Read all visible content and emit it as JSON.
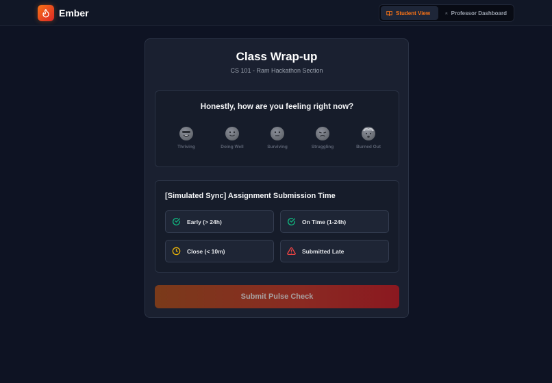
{
  "header": {
    "brand": "Ember",
    "accent": "#f97316",
    "logo_icon": "flame-icon",
    "tabs": [
      {
        "label": "Student View",
        "icon": "book-icon",
        "active": true
      },
      {
        "label": "Professor Dashboard",
        "icon": "users-icon",
        "active": false
      }
    ]
  },
  "card": {
    "title": "Class Wrap-up",
    "subtitle": "CS 101 - Ram Hackathon Section"
  },
  "mood": {
    "question": "Honestly, how are you feeling right now?",
    "options": [
      {
        "label": "Thriving",
        "icon": "star-struck-face-icon"
      },
      {
        "label": "Doing Well",
        "icon": "smiling-face-icon"
      },
      {
        "label": "Surviving",
        "icon": "neutral-face-icon"
      },
      {
        "label": "Struggling",
        "icon": "weary-face-icon"
      },
      {
        "label": "Burned Out",
        "icon": "exploding-head-icon"
      }
    ]
  },
  "sync": {
    "title": "[Simulated Sync] Assignment Submission Time",
    "options": [
      {
        "label": "Early (> 24h)",
        "icon": "check-circle-icon",
        "color": "#10b981"
      },
      {
        "label": "On Time (1-24h)",
        "icon": "check-circle-icon",
        "color": "#10b981"
      },
      {
        "label": "Close (< 10m)",
        "icon": "clock-icon",
        "color": "#eab308"
      },
      {
        "label": "Submitted Late",
        "icon": "warning-triangle-icon",
        "color": "#ef4444"
      }
    ]
  },
  "submit": {
    "label": "Submit Pulse Check"
  }
}
